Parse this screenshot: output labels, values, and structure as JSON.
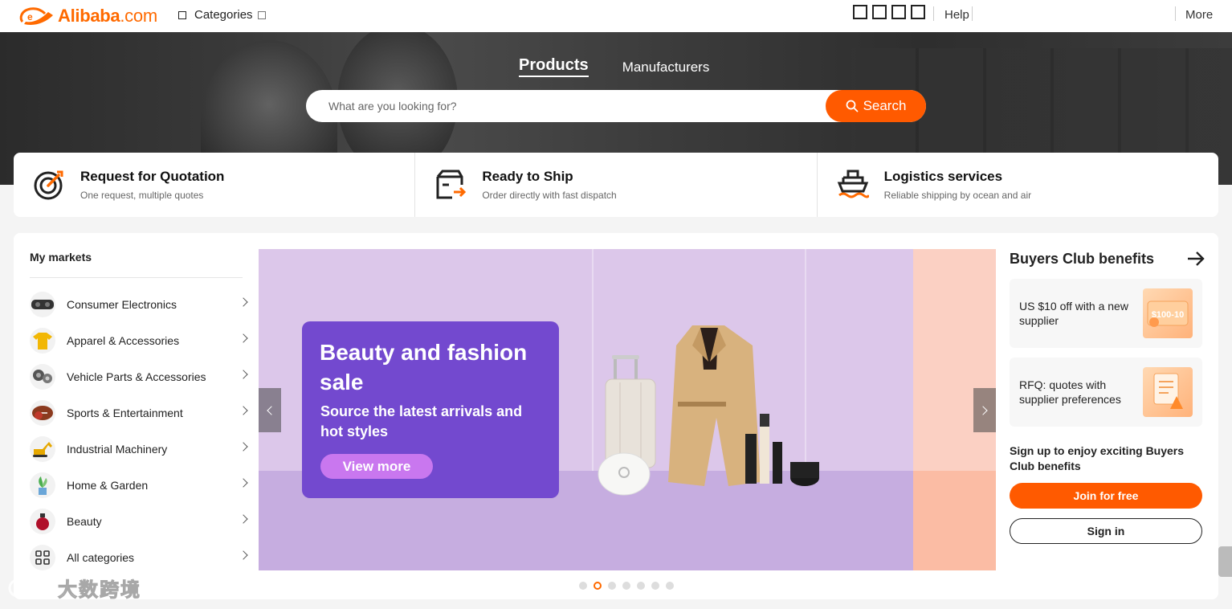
{
  "header": {
    "logo_brand": "Alibaba",
    "logo_suffix": ".com",
    "categories_label": "Categories",
    "help_label": "Help",
    "more_label": "More"
  },
  "hero": {
    "tabs": [
      {
        "label": "Products",
        "active": true
      },
      {
        "label": "Manufacturers",
        "active": false
      }
    ],
    "search_placeholder": "What are you looking for?",
    "search_button": "Search"
  },
  "services": [
    {
      "title": "Request for Quotation",
      "subtitle": "One request, multiple quotes",
      "icon": "target-icon"
    },
    {
      "title": "Ready to Ship",
      "subtitle": "Order directly with fast dispatch",
      "icon": "box-arrow-icon"
    },
    {
      "title": "Logistics services",
      "subtitle": "Reliable shipping by ocean and air",
      "icon": "ship-icon"
    }
  ],
  "markets": {
    "title": "My markets",
    "items": [
      {
        "label": "Consumer Electronics",
        "icon": "vr-headset-icon"
      },
      {
        "label": "Apparel & Accessories",
        "icon": "tshirt-icon"
      },
      {
        "label": "Vehicle Parts & Accessories",
        "icon": "car-parts-icon"
      },
      {
        "label": "Sports & Entertainment",
        "icon": "football-icon"
      },
      {
        "label": "Industrial Machinery",
        "icon": "excavator-icon"
      },
      {
        "label": "Home & Garden",
        "icon": "plant-icon"
      },
      {
        "label": "Beauty",
        "icon": "perfume-icon"
      },
      {
        "label": "All categories",
        "icon": "grid-icon"
      }
    ]
  },
  "banner": {
    "title": "Beauty and fashion sale",
    "subtitle": "Source the latest arrivals and hot styles",
    "button": "View more",
    "slide_count": 7,
    "active_slide": 2
  },
  "buyers_club": {
    "title": "Buyers Club benefits",
    "cards": [
      {
        "text": "US $10 off with a new supplier",
        "image_label": "$100-10"
      },
      {
        "text": "RFQ: quotes with supplier preferences"
      }
    ],
    "signup_text": "Sign up to enjoy exciting Buyers Club benefits",
    "join_button": "Join for free",
    "signin_button": "Sign in"
  },
  "watermark": {
    "text": "大数跨境"
  },
  "colors": {
    "brand_orange": "#ff6a00",
    "promo_purple": "#7349cf",
    "banner_bg": "#dcc7ea"
  }
}
